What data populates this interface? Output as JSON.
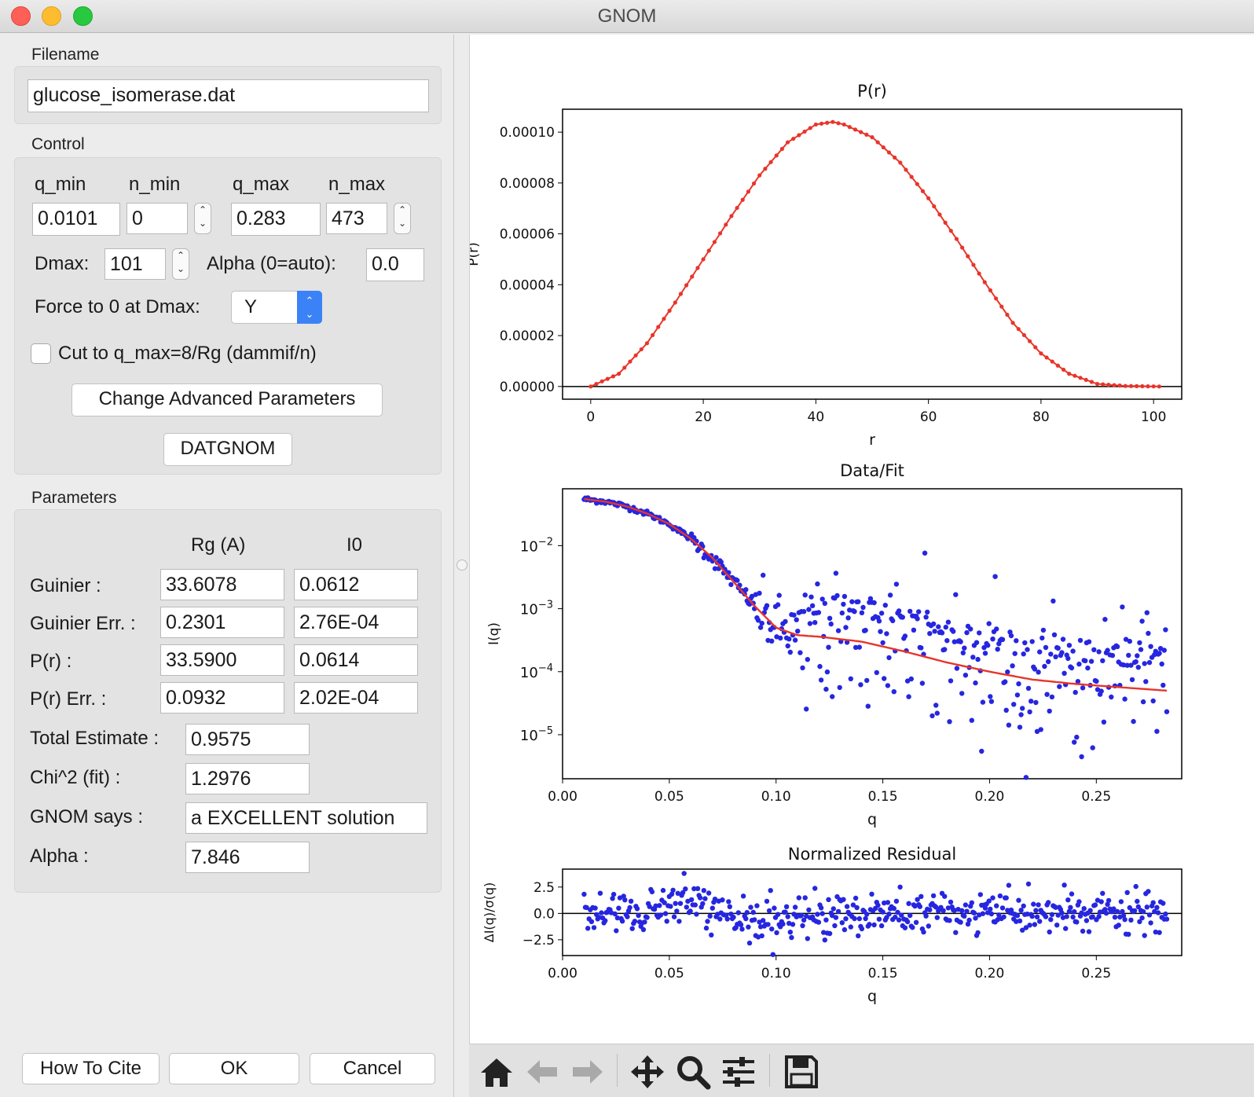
{
  "window": {
    "title": "GNOM"
  },
  "filename": {
    "label": "Filename",
    "value": "glucose_isomerase.dat"
  },
  "control": {
    "label": "Control",
    "q_min_label": "q_min",
    "n_min_label": "n_min",
    "q_max_label": "q_max",
    "n_max_label": "n_max",
    "q_min": "0.0101",
    "n_min": "0",
    "q_max": "0.283",
    "n_max": "473",
    "dmax_label": "Dmax:",
    "dmax": "101",
    "alpha_label": "Alpha (0=auto):",
    "alpha": "0.0",
    "force_label": "Force to 0 at Dmax:",
    "force_value": "Y",
    "cut_label": "Cut to q_max=8/Rg (dammif/n)",
    "cut_checked": false,
    "advanced_button": "Change Advanced Parameters",
    "datgnom_button": "DATGNOM"
  },
  "parameters": {
    "label": "Parameters",
    "col_rg": "Rg (A)",
    "col_i0": "I0",
    "rows": [
      {
        "label": "Guinier :",
        "rg": "33.6078",
        "i0": "0.0612"
      },
      {
        "label": "Guinier Err. :",
        "rg": "0.2301",
        "i0": "2.76E-04"
      },
      {
        "label": "P(r) :",
        "rg": "33.5900",
        "i0": "0.0614"
      },
      {
        "label": "P(r) Err. :",
        "rg": "0.0932",
        "i0": "2.02E-04"
      }
    ],
    "total_label": "Total Estimate :",
    "total": "0.9575",
    "chi_label": "Chi^2 (fit) :",
    "chi": "1.2976",
    "says_label": "GNOM says :",
    "says": "a EXCELLENT solution",
    "alpha_label": "Alpha :",
    "alpha": "7.846"
  },
  "buttons": {
    "cite": "How To Cite",
    "ok": "OK",
    "cancel": "Cancel"
  },
  "chart_data": [
    {
      "type": "line",
      "title": "P(r)",
      "xlabel": "r",
      "ylabel": "P(r)",
      "xlim": [
        -5,
        105
      ],
      "ylim": [
        -5e-06,
        0.000109
      ],
      "xticks": [
        "0",
        "20",
        "40",
        "60",
        "80",
        "100"
      ],
      "yticks": [
        "0.00000",
        "0.00002",
        "0.00004",
        "0.00006",
        "0.00008",
        "0.00010"
      ],
      "series": [
        {
          "color": "#e8352a",
          "x": [
            0,
            5,
            10,
            15,
            20,
            25,
            30,
            35,
            40,
            43,
            45,
            50,
            55,
            60,
            65,
            70,
            75,
            80,
            85,
            90,
            95,
            101
          ],
          "y": [
            0,
            5e-06,
            1.7e-05,
            3.3e-05,
            5e-05,
            6.7e-05,
            8.3e-05,
            9.6e-05,
            0.000103,
            0.000104,
            0.000103,
            9.8e-05,
            8.8e-05,
            7.4e-05,
            5.8e-05,
            4.1e-05,
            2.5e-05,
            1.3e-05,
            5e-06,
            1e-06,
            2e-07,
            0
          ]
        }
      ]
    },
    {
      "type": "scatter",
      "title": "Data/Fit",
      "xlabel": "q",
      "ylabel": "I(q)",
      "yscale": "log",
      "xlim": [
        0.0,
        0.29
      ],
      "ylim": [
        2e-06,
        0.08
      ],
      "xticks": [
        "0.00",
        "0.05",
        "0.10",
        "0.15",
        "0.20",
        "0.25"
      ],
      "yticks": [
        "10^-5",
        "10^-4",
        "10^-3",
        "10^-2"
      ],
      "series": [
        {
          "type": "line",
          "color": "#e8352a",
          "x": [
            0.0101,
            0.02,
            0.03,
            0.04,
            0.05,
            0.06,
            0.07,
            0.08,
            0.09,
            0.1,
            0.11,
            0.12,
            0.14,
            0.16,
            0.18,
            0.2,
            0.22,
            0.24,
            0.26,
            0.283
          ],
          "y": [
            0.055,
            0.05,
            0.042,
            0.032,
            0.022,
            0.013,
            0.0065,
            0.0027,
            0.0011,
            0.0005,
            0.00038,
            0.00036,
            0.0003,
            0.00021,
            0.00014,
            0.0001,
            7.5e-05,
            6.4e-05,
            5.7e-05,
            5e-05
          ]
        }
      ]
    },
    {
      "type": "scatter",
      "title": "Normalized Residual",
      "xlabel": "q",
      "ylabel": "ΔI(q)/σ(q)",
      "xlim": [
        0.0,
        0.29
      ],
      "ylim": [
        -4.0,
        4.2
      ],
      "xticks": [
        "0.00",
        "0.05",
        "0.10",
        "0.15",
        "0.20",
        "0.25"
      ],
      "yticks": [
        "-2.5",
        "0.0",
        "2.5"
      ],
      "series": [
        {
          "color": "#2626e0",
          "x_range": [
            0.0101,
            0.283
          ],
          "count": 473
        }
      ]
    }
  ]
}
